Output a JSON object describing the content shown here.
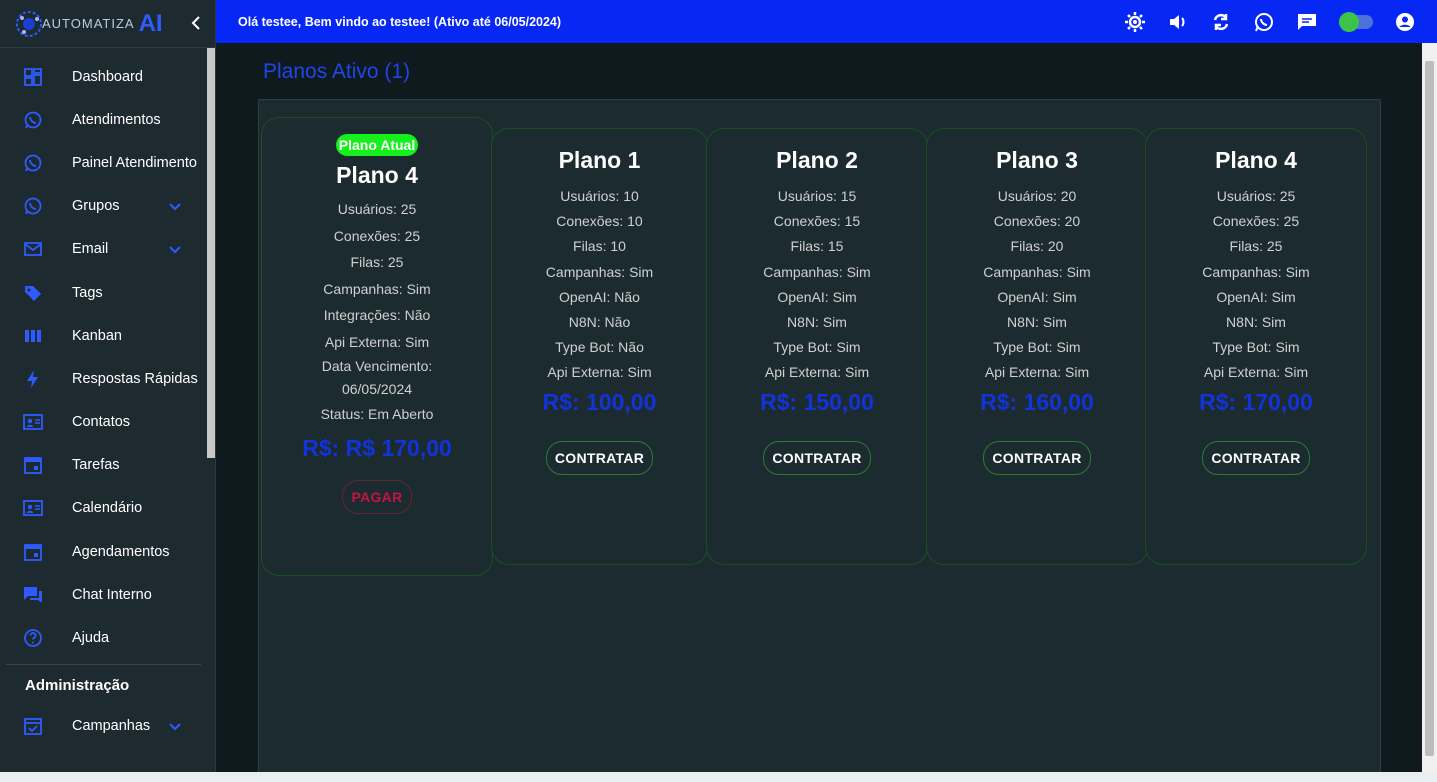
{
  "brand": {
    "text": "AUTOMATIZA",
    "accent": "AI"
  },
  "topbar": {
    "greeting": "Olá testee, Bem vindo ao testee! (Ativo até 06/05/2024)"
  },
  "sidebar": {
    "items": [
      {
        "label": "Dashboard",
        "icon": "dashboard-icon"
      },
      {
        "label": "Atendimentos",
        "icon": "whatsapp-icon"
      },
      {
        "label": "Painel Atendimento",
        "icon": "whatsapp-icon"
      },
      {
        "label": "Grupos",
        "icon": "whatsapp-icon",
        "expandable": true
      },
      {
        "label": "Email",
        "icon": "mail-icon",
        "expandable": true
      },
      {
        "label": "Tags",
        "icon": "tag-icon"
      },
      {
        "label": "Kanban",
        "icon": "kanban-icon"
      },
      {
        "label": "Respostas Rápidas",
        "icon": "bolt-icon"
      },
      {
        "label": "Contatos",
        "icon": "contacts-icon"
      },
      {
        "label": "Tarefas",
        "icon": "calendar-icon"
      },
      {
        "label": "Calendário",
        "icon": "contacts-icon"
      },
      {
        "label": "Agendamentos",
        "icon": "calendar-icon"
      },
      {
        "label": "Chat Interno",
        "icon": "chat-icon"
      },
      {
        "label": "Ajuda",
        "icon": "help-icon"
      }
    ],
    "section_title": "Administração",
    "admin_items": [
      {
        "label": "Campanhas",
        "icon": "event-icon",
        "expandable": true
      }
    ]
  },
  "page": {
    "title": "Planos Ativo (1)"
  },
  "current_plan": {
    "badge": "Plano Atual",
    "name": "Plano 4",
    "features": [
      "Usuários: 25",
      "Conexões: 25",
      "Filas: 25",
      "Campanhas: Sim",
      "Integrações: Não",
      "Api Externa: Sim",
      "Data Vencimento:",
      "06/05/2024",
      "Status: Em Aberto"
    ],
    "price": "R$: R$ 170,00",
    "button": "PAGAR"
  },
  "plans": [
    {
      "name": "Plano 1",
      "features": [
        "Usuários: 10",
        "Conexões: 10",
        "Filas: 10",
        "Campanhas: Sim",
        "OpenAI: Não",
        "N8N: Não",
        "Type Bot: Não",
        "Api Externa: Sim"
      ],
      "price": "R$: 100,00",
      "button": "CONTRATAR"
    },
    {
      "name": "Plano 2",
      "features": [
        "Usuários: 15",
        "Conexões: 15",
        "Filas: 15",
        "Campanhas: Sim",
        "OpenAI: Sim",
        "N8N: Sim",
        "Type Bot: Sim",
        "Api Externa: Sim"
      ],
      "price": "R$: 150,00",
      "button": "CONTRATAR"
    },
    {
      "name": "Plano 3",
      "features": [
        "Usuários: 20",
        "Conexões: 20",
        "Filas: 20",
        "Campanhas: Sim",
        "OpenAI: Sim",
        "N8N: Sim",
        "Type Bot: Sim",
        "Api Externa: Sim"
      ],
      "price": "R$: 160,00",
      "button": "CONTRATAR"
    },
    {
      "name": "Plano 4",
      "features": [
        "Usuários: 25",
        "Conexões: 25",
        "Filas: 25",
        "Campanhas: Sim",
        "OpenAI: Sim",
        "N8N: Sim",
        "Type Bot: Sim",
        "Api Externa: Sim"
      ],
      "price": "R$: 170,00",
      "button": "CONTRATAR"
    }
  ],
  "colors": {
    "topbar": "#0727f5",
    "accent": "#1f46e8",
    "price": "#1233d8",
    "badge": "#15ef1c",
    "pay": "#c41442"
  }
}
